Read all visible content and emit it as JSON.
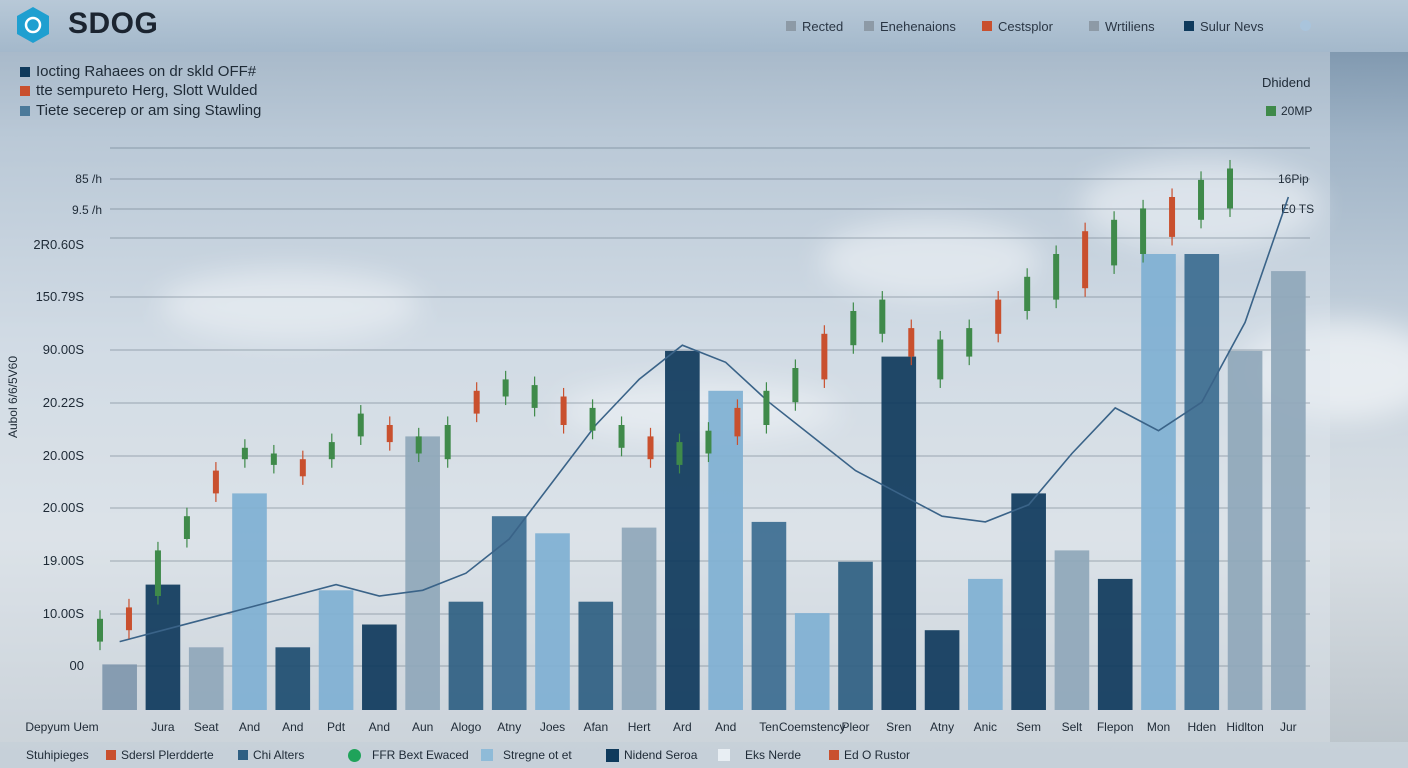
{
  "app": {
    "brand": "SDOG"
  },
  "legend_top": [
    {
      "label": "Rected",
      "color": "#8d9aa6"
    },
    {
      "label": "Enehenaions",
      "color": "#8d9aa6"
    },
    {
      "label": "Cestsplor",
      "color": "#c9502e"
    },
    {
      "label": "Wrtiliens",
      "color": "#8d9aa6"
    },
    {
      "label": "Sulur Nevs",
      "color": "#0f3a5c"
    }
  ],
  "notes": [
    {
      "text": "Iocting Rahaees on dr skld OFF#",
      "color": "#0f3a5c"
    },
    {
      "text": "tte sempureto Herg, Slott Wulded",
      "color": "#c9502e"
    },
    {
      "text": "Tiete secerep or am sing Stawling",
      "color": "#4c7a9a"
    }
  ],
  "right_labels": [
    {
      "text": "Dhidend"
    },
    {
      "text": "20MP",
      "color": "#3f8a4a"
    },
    {
      "text": "16Pip"
    },
    {
      "text": "E0 TS"
    }
  ],
  "chart_data": {
    "type": "bar",
    "title": "",
    "ylabel": "Aubol 6/6/5V60",
    "y_ticks": [
      "00",
      "10.00S",
      "19.00S",
      "20.00S",
      "20.00S",
      "20.22S",
      "90.00S",
      "150.79S",
      "2R0.60S",
      "9.5 /h",
      "85 /h"
    ],
    "categories": [
      "Depyum Uem",
      "Jura",
      "Seat",
      "And",
      "And",
      "Pdt",
      "And",
      "Aun",
      "Alogo",
      "Atny",
      "Joes",
      "Afan",
      "Hert",
      "Ard",
      "And",
      "Ten",
      "Coemstency",
      "Pleor",
      "Sren",
      "Atny",
      "Anic",
      "Sem",
      "Selt",
      "Flepon",
      "Mon",
      "Hden",
      "Hidlton",
      "Jur"
    ],
    "bars": {
      "values": [
        8,
        22,
        11,
        38,
        11,
        21,
        15,
        48,
        19,
        34,
        31,
        19,
        32,
        63,
        56,
        33,
        17,
        26,
        62,
        14,
        23,
        38,
        28,
        23,
        80,
        80,
        63,
        77
      ],
      "colors": [
        "#7f97ad",
        "#0f3a5c",
        "#8fa7ba",
        "#7fb0d3",
        "#1d4d70",
        "#7fb0d3",
        "#0f3a5c",
        "#8fa7ba",
        "#2f5f82",
        "#3c6c90",
        "#7fb0d3",
        "#2f5f82",
        "#8fa7ba",
        "#0f3a5c",
        "#7fb0d3",
        "#3c6c90",
        "#7fb0d3",
        "#2f5f82",
        "#0f3a5c",
        "#0f3a5c",
        "#7fb0d3",
        "#0f3a5c",
        "#8fa7ba",
        "#0f3a5c",
        "#7fb0d3",
        "#3c6c90",
        "#8fa7ba",
        "#8fa7ba"
      ]
    },
    "line": [
      12,
      14,
      16,
      18,
      20,
      22,
      20,
      21,
      24,
      30,
      40,
      50,
      58,
      64,
      61,
      54,
      48,
      42,
      38,
      34,
      33,
      36,
      45,
      53,
      49,
      54,
      68,
      90
    ],
    "candles": [
      [
        12,
        16
      ],
      [
        14,
        18
      ],
      [
        20,
        28
      ],
      [
        30,
        34
      ],
      [
        38,
        42
      ],
      [
        44,
        46
      ],
      [
        43,
        45
      ],
      [
        41,
        44
      ],
      [
        44,
        47
      ],
      [
        48,
        52
      ],
      [
        47,
        50
      ],
      [
        45,
        48
      ],
      [
        44,
        50
      ],
      [
        52,
        56
      ],
      [
        55,
        58
      ],
      [
        53,
        57
      ],
      [
        50,
        55
      ],
      [
        49,
        53
      ],
      [
        46,
        50
      ],
      [
        44,
        48
      ],
      [
        43,
        47
      ],
      [
        45,
        49
      ],
      [
        48,
        53
      ],
      [
        50,
        56
      ],
      [
        54,
        60
      ],
      [
        58,
        66
      ],
      [
        64,
        70
      ],
      [
        66,
        72
      ],
      [
        62,
        67
      ],
      [
        58,
        65
      ],
      [
        62,
        67
      ],
      [
        66,
        72
      ],
      [
        70,
        76
      ],
      [
        72,
        80
      ],
      [
        74,
        84
      ],
      [
        78,
        86
      ],
      [
        80,
        88
      ],
      [
        83,
        90
      ],
      [
        86,
        93
      ],
      [
        88,
        95
      ]
    ],
    "candle_up": "#3f8a4a",
    "candle_down": "#c9502e",
    "line_color": "#3a6388",
    "ylim": [
      0,
      100
    ]
  },
  "bottom_legend": [
    {
      "label": "Stuhipieges",
      "color": ""
    },
    {
      "label": "Sdersl Plerdderte",
      "color": "#c9502e"
    },
    {
      "label": "Chi Alters",
      "color": "#2f5f82"
    },
    {
      "label": "FFR Bext Ewaced",
      "color": "#1fa35a"
    },
    {
      "label": "Stregne ot et",
      "color": "#8fbbd8"
    },
    {
      "label": "Nidend Seroa",
      "color": "#0f3a5c"
    },
    {
      "label": "Eks Nerde",
      "color": "#cfd7de"
    },
    {
      "label": "Ed O Rustor",
      "color": "#c9502e"
    }
  ]
}
